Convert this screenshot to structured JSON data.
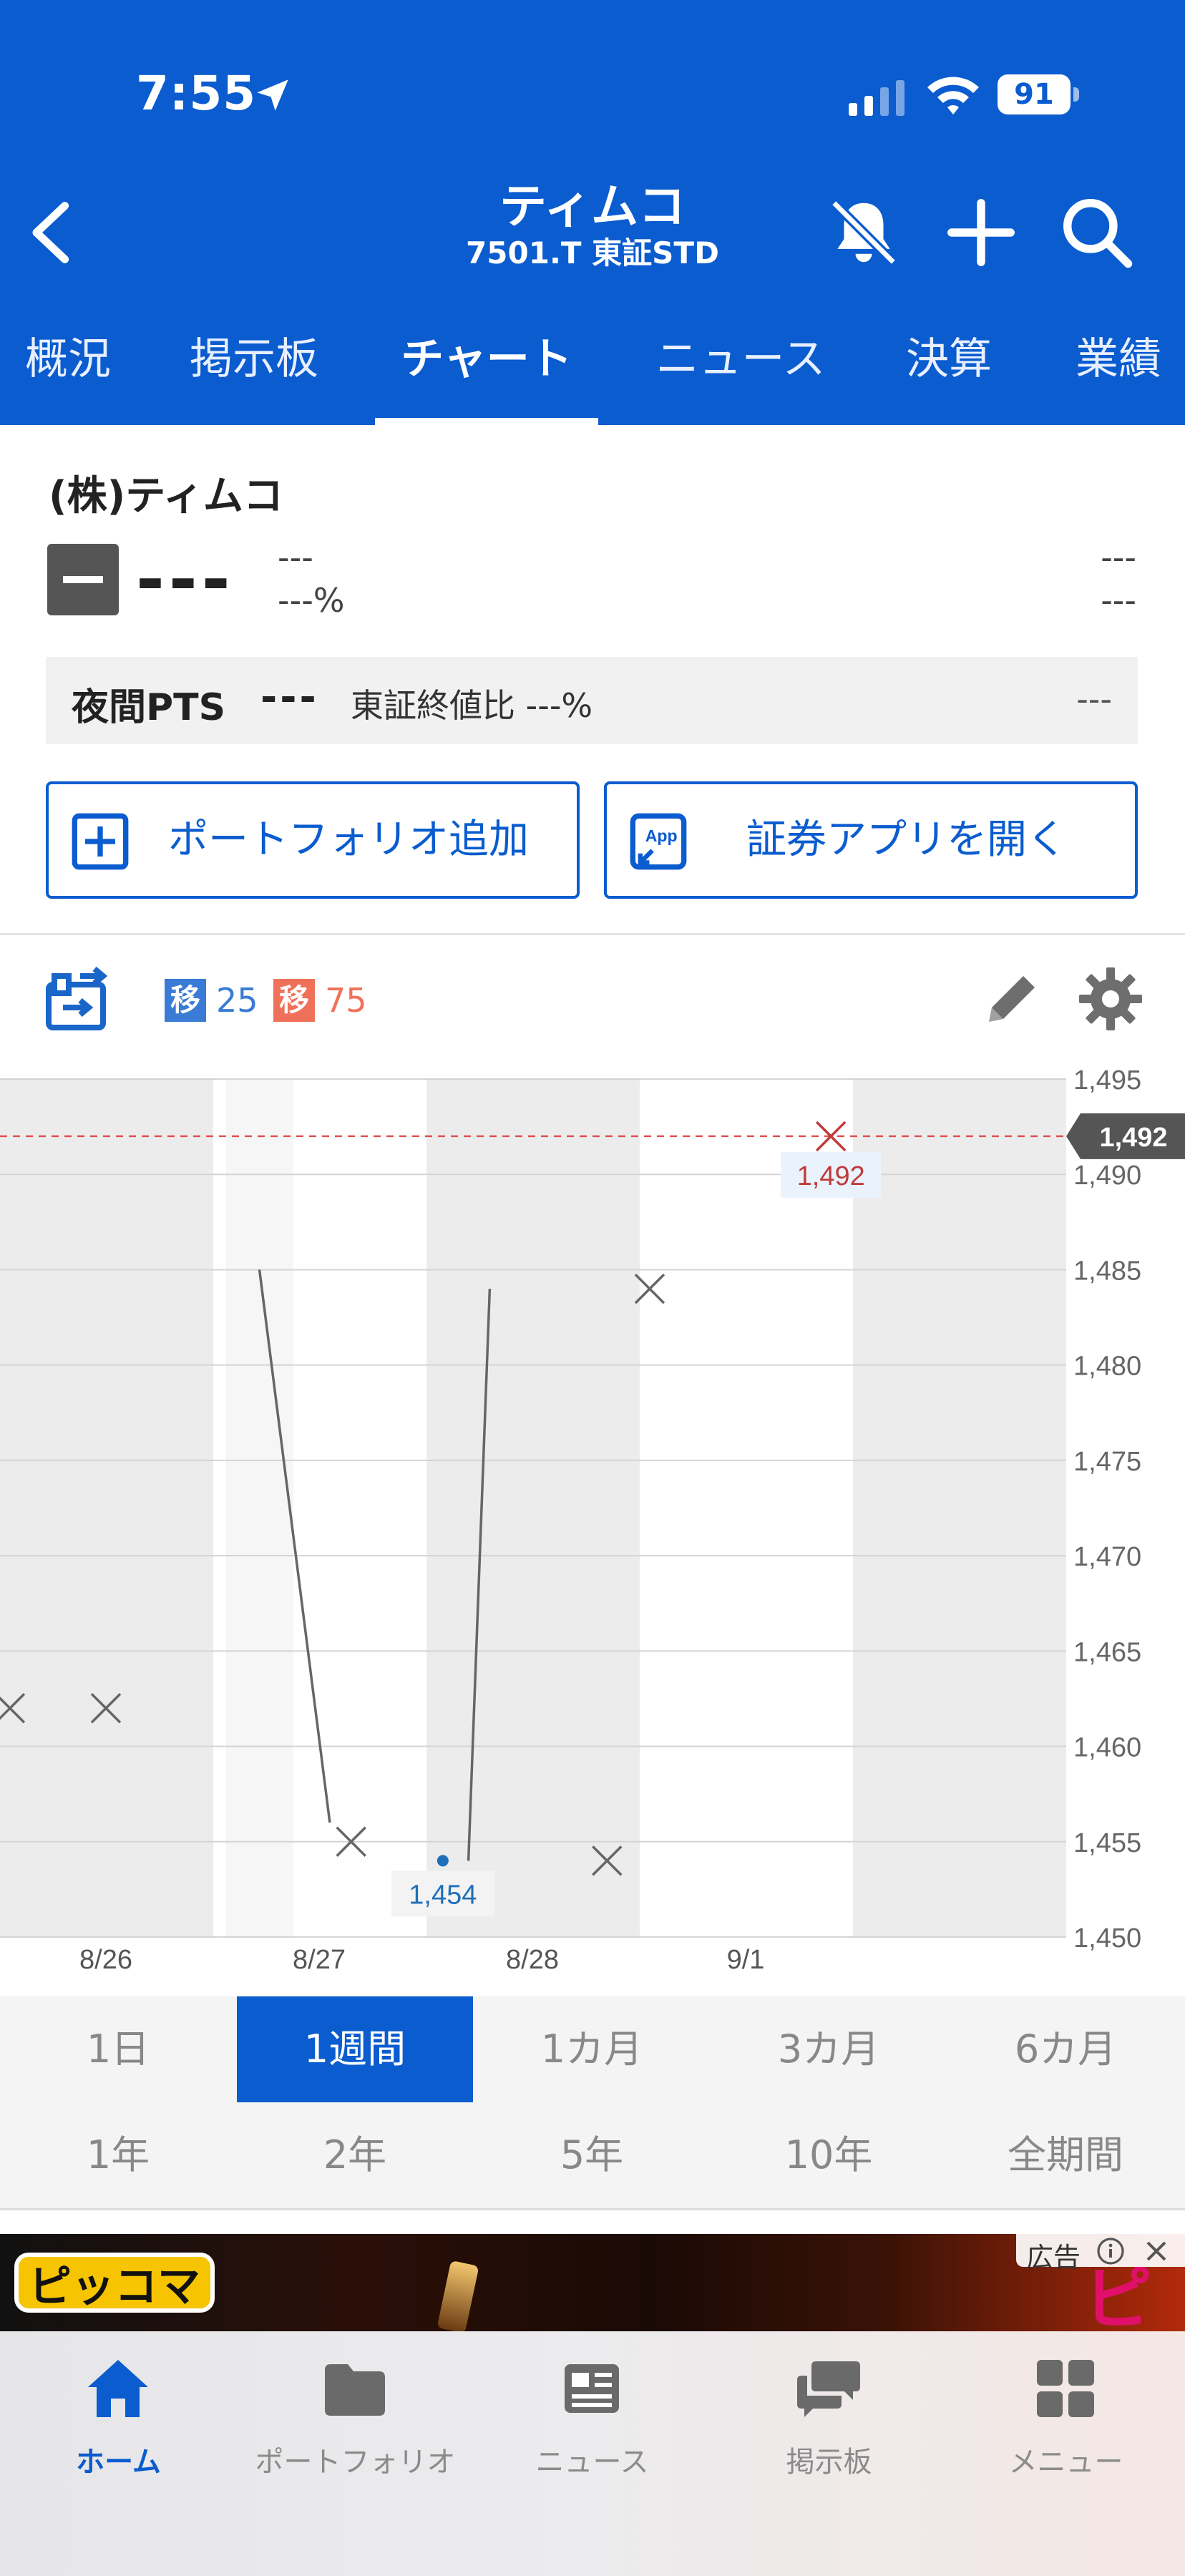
{
  "status": {
    "time": "7:55",
    "battery": "91"
  },
  "header": {
    "title": "ティムコ",
    "subtitle": "7501.T 東証STD"
  },
  "tabs": [
    "概況",
    "掲示板",
    "チャート",
    "ニュース",
    "決算",
    "業績"
  ],
  "active_tab": "チャート",
  "quote": {
    "company": "(株)ティムコ",
    "price": "---",
    "change": "---",
    "change_pct": "---%",
    "right_top": "---",
    "right_bottom": "---"
  },
  "pts": {
    "label": "夜間PTS",
    "value": "---",
    "ratio": "東証終値比 ---%",
    "right": "---"
  },
  "buttons": {
    "portfolio": "ポートフォリオ追加",
    "app": "証券アプリを開く",
    "app_icon_text": "App"
  },
  "chart_toolbar": {
    "ma_short_tag": "移",
    "ma_short_value": "25",
    "ma_long_tag": "移",
    "ma_long_value": "75",
    "ma_short_color": "#3a7bd5",
    "ma_long_color": "#f0715a"
  },
  "chart_data": {
    "type": "line",
    "x_tick_labels": [
      "8/26",
      "8/27",
      "8/28",
      "9/1"
    ],
    "y_ticks": [
      "1,495",
      "1,490",
      "1,485",
      "1,480",
      "1,475",
      "1,470",
      "1,465",
      "1,460",
      "1,455",
      "1,450"
    ],
    "ylim": [
      1450,
      1495
    ],
    "current_price_label": "1,492",
    "current_price": 1492,
    "high_label": "1,492",
    "low_label": "1,454",
    "segments": [
      {
        "x1": 0.72,
        "y1": 1485,
        "x2": 1.05,
        "y2": 1456
      },
      {
        "x1": 1.7,
        "y1": 1454,
        "x2": 1.8,
        "y2": 1484
      }
    ],
    "markers": [
      {
        "x": -0.45,
        "y": 1462
      },
      {
        "x": 0.0,
        "y": 1462
      },
      {
        "x": 1.15,
        "y": 1455
      },
      {
        "x": 2.35,
        "y": 1454
      },
      {
        "x": 2.55,
        "y": 1484
      },
      {
        "x": 3.4,
        "y": 1492
      }
    ],
    "low_point": {
      "x": 1.58,
      "y": 1454
    },
    "grid": true
  },
  "periods": {
    "row1": [
      "1日",
      "1週間",
      "1カ月",
      "3カ月",
      "6カ月"
    ],
    "row2": [
      "1年",
      "2年",
      "5年",
      "10年",
      "全期間"
    ],
    "active": "1週間"
  },
  "ad": {
    "badge": "広告",
    "logo": "ピッコマ",
    "corner": "ピ"
  },
  "bottom_nav": [
    {
      "label": "ホーム",
      "icon": "home-icon",
      "active": true
    },
    {
      "label": "ポートフォリオ",
      "icon": "folder-icon",
      "active": false
    },
    {
      "label": "ニュース",
      "icon": "news-icon",
      "active": false
    },
    {
      "label": "掲示板",
      "icon": "chat-icon",
      "active": false
    },
    {
      "label": "メニュー",
      "icon": "grid-icon",
      "active": false
    }
  ],
  "colors": {
    "brand": "#0a5ccf",
    "down": "#2a6ab0",
    "up": "#d23c3c"
  }
}
